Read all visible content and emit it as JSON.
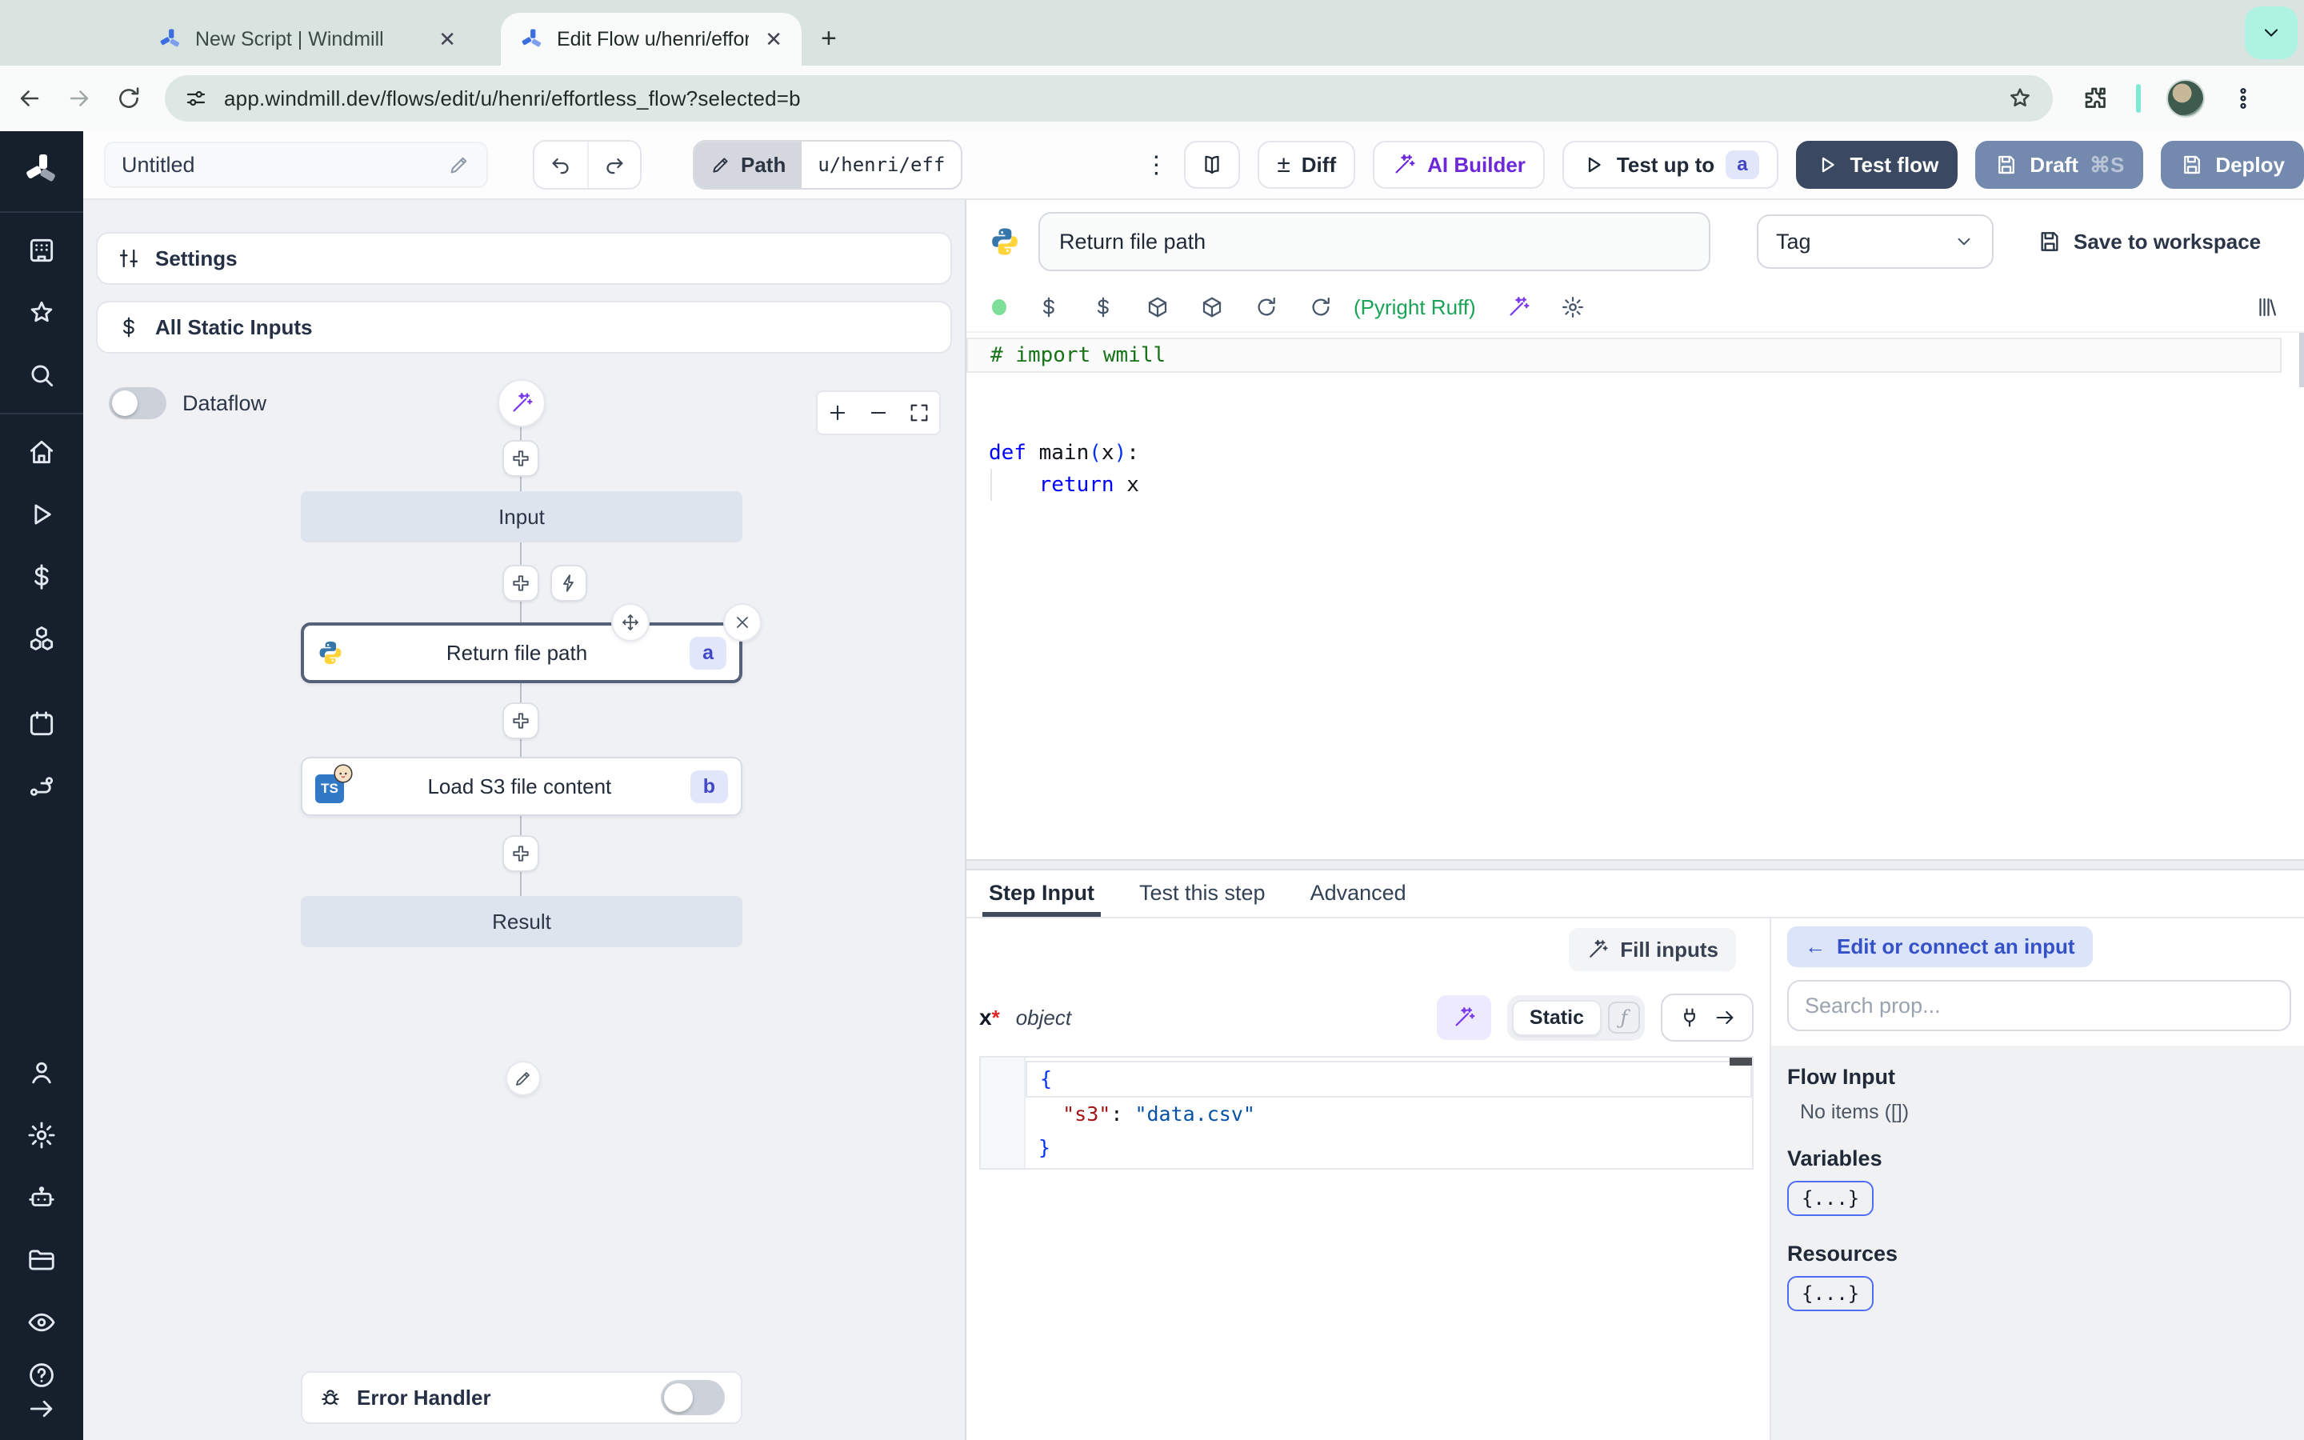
{
  "colors": {
    "accent_purple": "#7c3aed",
    "brand_blue": "#3b6fe0",
    "test_flow_navy": "#3a4961",
    "deploy_slate": "#7389ad",
    "mint_accent": "#aef2e2",
    "badge_bg": "#e2e6fb",
    "badge_text": "#4247c5",
    "lint_green": "#18a356",
    "selected_node_border": "#56617a",
    "sidebar_bg": "#161f2c"
  },
  "browser": {
    "tabs": [
      {
        "title": "New Script | Windmill"
      },
      {
        "title": "Edit Flow u/henri/effortless_fl"
      }
    ],
    "close_glyph": "✕",
    "new_tab_glyph": "+",
    "url": "app.windmill.dev/flows/edit/u/henri/effortless_flow?selected=b"
  },
  "toolbar": {
    "flow_name": "Untitled",
    "kebab_glyph": "⋮",
    "path_label": "Path",
    "path_value": "u/henri/eff",
    "diff_icon": "±",
    "diff_label": "Diff",
    "ai_builder_label": "AI Builder",
    "test_up_to_label": "Test up to",
    "test_up_to_badge": "a",
    "test_flow_label": "Test flow",
    "draft_label": "Draft",
    "draft_shortcut": "⌘S",
    "deploy_label": "Deploy"
  },
  "flow_panel": {
    "settings_label": "Settings",
    "static_inputs_label": "All Static Inputs",
    "dataflow_label": "Dataflow",
    "nodes": {
      "input_label": "Input",
      "step_a_title": "Return file path",
      "step_a_badge": "a",
      "step_b_title": "Load S3 file content",
      "step_b_badge": "b",
      "result_label": "Result"
    },
    "ts_logo_text": "TS",
    "error_handler_label": "Error Handler"
  },
  "editor": {
    "step_title": "Return file path",
    "tag_label": "Tag",
    "save_label": "Save to workspace",
    "lint_label": "(Pyright Ruff)",
    "code_lines": [
      {
        "current": true,
        "tokens": [
          {
            "c": "comment",
            "t": "# import wmill"
          }
        ]
      },
      {
        "tokens": []
      },
      {
        "tokens": []
      },
      {
        "tokens": [
          {
            "c": "kw",
            "t": "def"
          },
          {
            "c": "plain",
            "t": " main"
          },
          {
            "c": "paren",
            "t": "("
          },
          {
            "c": "plain",
            "t": "x"
          },
          {
            "c": "paren",
            "t": ")"
          },
          {
            "c": "plain",
            "t": ":"
          }
        ]
      },
      {
        "guide": true,
        "tokens": [
          {
            "c": "plain",
            "t": "    "
          },
          {
            "c": "kw",
            "t": "return"
          },
          {
            "c": "plain",
            "t": " x"
          }
        ]
      }
    ]
  },
  "step_panel": {
    "tabs": [
      "Step Input",
      "Test this step",
      "Advanced"
    ],
    "fill_inputs_label": "Fill inputs",
    "arg_name": "x",
    "arg_required": "*",
    "arg_type": "object",
    "static_label": "Static",
    "fn_glyph": "ƒ",
    "json_lines": [
      {
        "current": true,
        "tokens": [
          {
            "c": "brace",
            "t": "{"
          }
        ]
      },
      {
        "tokens": [
          {
            "c": "plain",
            "t": "  "
          },
          {
            "c": "key",
            "t": "\"s3\""
          },
          {
            "c": "plain",
            "t": ": "
          },
          {
            "c": "str",
            "t": "\"data.csv\""
          }
        ]
      },
      {
        "tokens": [
          {
            "c": "brace",
            "t": "}"
          }
        ]
      }
    ]
  },
  "connect_panel": {
    "back_arrow": "←",
    "edit_connect_label": "Edit or connect an input",
    "search_placeholder": "Search prop...",
    "flow_input_label": "Flow Input",
    "flow_input_empty": "No items ([])",
    "variables_label": "Variables",
    "variables_braces": "{...}",
    "resources_label": "Resources",
    "resources_braces": "{...}"
  }
}
